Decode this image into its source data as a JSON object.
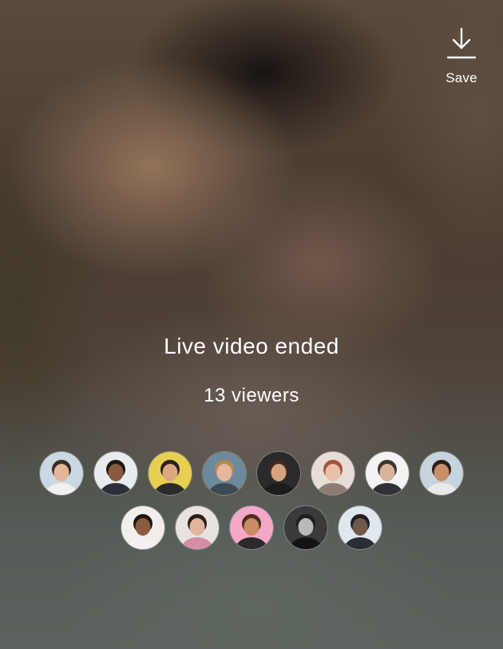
{
  "header": {
    "save_label": "Save",
    "save_icon": "download-icon"
  },
  "status": {
    "title": "Live video ended",
    "viewer_count": "13 viewers"
  },
  "viewers": {
    "row1": [
      {
        "name": "viewer-1",
        "bg": "#c9d8e3",
        "skin": "#e3b796",
        "hair": "#3a2b25",
        "shirt": "#f0f0f0"
      },
      {
        "name": "viewer-2",
        "bg": "#e9ecef",
        "skin": "#8a5a3e",
        "hair": "#1d1714",
        "shirt": "#2c2f3a"
      },
      {
        "name": "viewer-3",
        "bg": "#e7cf52",
        "skin": "#d9a882",
        "hair": "#2a211b",
        "shirt": "#2b2b2b"
      },
      {
        "name": "viewer-4",
        "bg": "#6d8a9c",
        "skin": "#e3b89a",
        "hair": "#b08a55",
        "shirt": "#3d4a54"
      },
      {
        "name": "viewer-5",
        "bg": "#2a2a2a",
        "skin": "#d6a37f",
        "hair": "#3b2a20",
        "shirt": "#1c1c1c"
      },
      {
        "name": "viewer-6",
        "bg": "#e7dcd6",
        "skin": "#eac1a6",
        "hair": "#a3543a",
        "shirt": "#8d7c74"
      },
      {
        "name": "viewer-7",
        "bg": "#f3f3f3",
        "skin": "#d8b39b",
        "hair": "#3e342e",
        "shirt": "#2f3136"
      },
      {
        "name": "viewer-8",
        "bg": "#c7d4de",
        "skin": "#c98f6a",
        "hair": "#2a1e18",
        "shirt": "#e9e9e9"
      }
    ],
    "row2": [
      {
        "name": "viewer-9",
        "bg": "#f2eee9",
        "skin": "#8b5c40",
        "hair": "#1c1612",
        "shirt": "#f2f2f2"
      },
      {
        "name": "viewer-10",
        "bg": "#e9e3e0",
        "skin": "#e0b59b",
        "hair": "#2a1f1b",
        "shirt": "#d78da6"
      },
      {
        "name": "viewer-11",
        "bg": "#f4a8c7",
        "skin": "#c98c64",
        "hair": "#4a2f22",
        "shirt": "#2a2a2a"
      },
      {
        "name": "viewer-12",
        "bg": "#3a3a3a",
        "skin": "#b9b9b9",
        "hair": "#1e1e1e",
        "shirt": "#141414"
      },
      {
        "name": "viewer-13",
        "bg": "#dfe7ef",
        "skin": "#6f5a4a",
        "hair": "#1f1f24",
        "shirt": "#2c2c34"
      }
    ]
  }
}
